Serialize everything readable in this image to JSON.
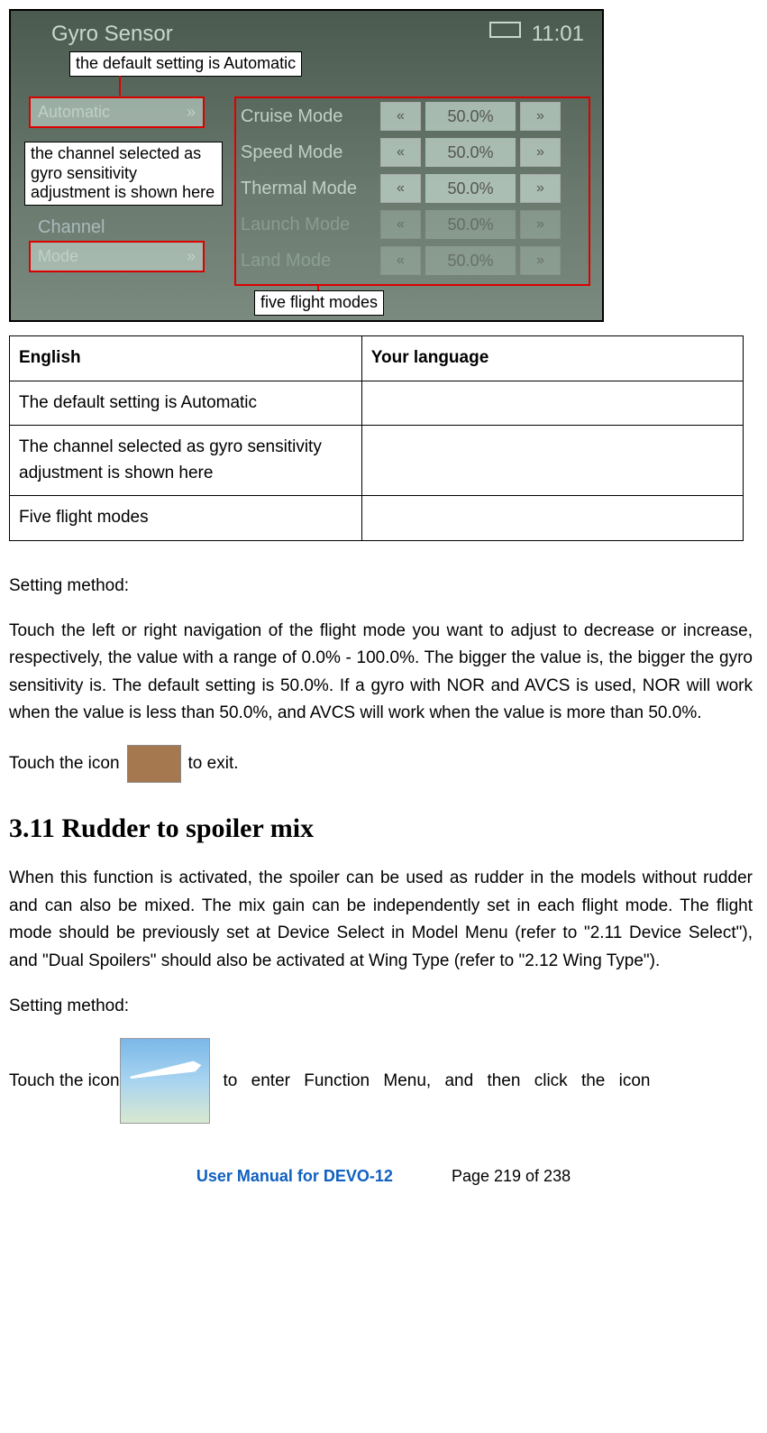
{
  "screenshot": {
    "title": "Gyro Sensor",
    "clock": "11:01",
    "callout_default": "the default setting is Automatic",
    "callout_channel": "the channel selected as gyro sensitivity adjustment is shown here",
    "callout_modes": "five flight modes",
    "automatic_label": "Automatic",
    "channel_label": "Channel",
    "mode_btn_label": "Mode",
    "modes": [
      {
        "name": "Cruise Mode",
        "value": "50.0%",
        "dim": false
      },
      {
        "name": "Speed Mode",
        "value": "50.0%",
        "dim": false
      },
      {
        "name": "Thermal Mode",
        "value": "50.0%",
        "dim": false
      },
      {
        "name": "Launch Mode",
        "value": "50.0%",
        "dim": true
      },
      {
        "name": "Land Mode",
        "value": "50.0%",
        "dim": true
      }
    ]
  },
  "table": {
    "header_left": "English",
    "header_right": "Your language",
    "rows": [
      {
        "left": "The default setting is Automatic",
        "right": ""
      },
      {
        "left": "The channel selected as gyro sensitivity adjustment is shown here",
        "right": ""
      },
      {
        "left": "Five flight modes",
        "right": ""
      }
    ]
  },
  "body": {
    "setting_method": "Setting method:",
    "para1": "Touch the left or right navigation of the flight mode you want to adjust to decrease or increase, respectively, the value with a range of 0.0% - 100.0%. The bigger the value is, the bigger the gyro sensitivity is. The default setting is 50.0%. If a gyro with NOR and AVCS is used, NOR will work when the value is less than 50.0%, and AVCS will work when the value is more than 50.0%.",
    "touch_icon_prefix": "Touch the icon",
    "touch_icon_suffix": " to exit.",
    "heading": "3.11 Rudder to spoiler mix",
    "para2": "When this function is activated, the spoiler can be used as rudder in the models without rudder and can also be mixed. The mix gain can be independently set in each flight mode. The flight mode should be previously set at Device Select in Model Menu (refer to \"2.11 Device Select\"), and \"Dual Spoilers\" should also be activated at Wing Type (refer to \"2.12 Wing Type\").",
    "setting_method2": "Setting method:",
    "touch2_prefix": "Touch  the  icon",
    "touch2_suffix": "to  enter  Function  Menu,  and  then  click  the  icon"
  },
  "footer": {
    "title": "User Manual for DEVO-12",
    "page": "Page 219 of 238"
  }
}
